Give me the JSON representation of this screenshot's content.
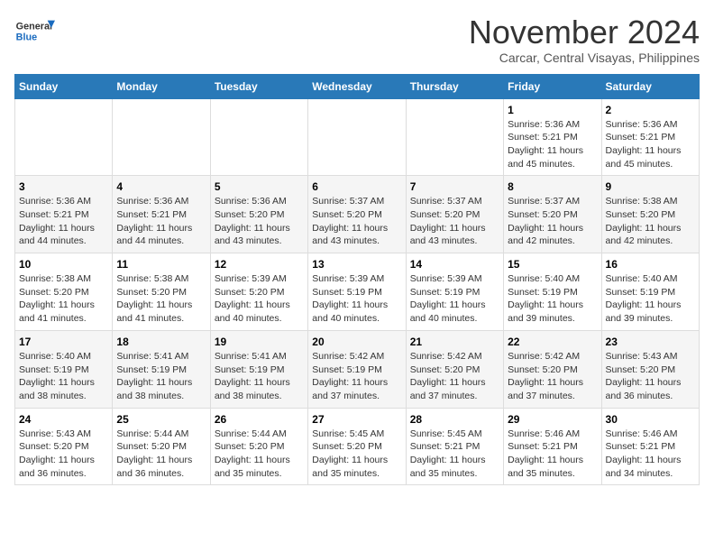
{
  "header": {
    "logo_line1": "General",
    "logo_line2": "Blue",
    "month_title": "November 2024",
    "subtitle": "Carcar, Central Visayas, Philippines"
  },
  "days_of_week": [
    "Sunday",
    "Monday",
    "Tuesday",
    "Wednesday",
    "Thursday",
    "Friday",
    "Saturday"
  ],
  "weeks": [
    [
      {
        "day": "",
        "info": ""
      },
      {
        "day": "",
        "info": ""
      },
      {
        "day": "",
        "info": ""
      },
      {
        "day": "",
        "info": ""
      },
      {
        "day": "",
        "info": ""
      },
      {
        "day": "1",
        "info": "Sunrise: 5:36 AM\nSunset: 5:21 PM\nDaylight: 11 hours and 45 minutes."
      },
      {
        "day": "2",
        "info": "Sunrise: 5:36 AM\nSunset: 5:21 PM\nDaylight: 11 hours and 45 minutes."
      }
    ],
    [
      {
        "day": "3",
        "info": "Sunrise: 5:36 AM\nSunset: 5:21 PM\nDaylight: 11 hours and 44 minutes."
      },
      {
        "day": "4",
        "info": "Sunrise: 5:36 AM\nSunset: 5:21 PM\nDaylight: 11 hours and 44 minutes."
      },
      {
        "day": "5",
        "info": "Sunrise: 5:36 AM\nSunset: 5:20 PM\nDaylight: 11 hours and 43 minutes."
      },
      {
        "day": "6",
        "info": "Sunrise: 5:37 AM\nSunset: 5:20 PM\nDaylight: 11 hours and 43 minutes."
      },
      {
        "day": "7",
        "info": "Sunrise: 5:37 AM\nSunset: 5:20 PM\nDaylight: 11 hours and 43 minutes."
      },
      {
        "day": "8",
        "info": "Sunrise: 5:37 AM\nSunset: 5:20 PM\nDaylight: 11 hours and 42 minutes."
      },
      {
        "day": "9",
        "info": "Sunrise: 5:38 AM\nSunset: 5:20 PM\nDaylight: 11 hours and 42 minutes."
      }
    ],
    [
      {
        "day": "10",
        "info": "Sunrise: 5:38 AM\nSunset: 5:20 PM\nDaylight: 11 hours and 41 minutes."
      },
      {
        "day": "11",
        "info": "Sunrise: 5:38 AM\nSunset: 5:20 PM\nDaylight: 11 hours and 41 minutes."
      },
      {
        "day": "12",
        "info": "Sunrise: 5:39 AM\nSunset: 5:20 PM\nDaylight: 11 hours and 40 minutes."
      },
      {
        "day": "13",
        "info": "Sunrise: 5:39 AM\nSunset: 5:19 PM\nDaylight: 11 hours and 40 minutes."
      },
      {
        "day": "14",
        "info": "Sunrise: 5:39 AM\nSunset: 5:19 PM\nDaylight: 11 hours and 40 minutes."
      },
      {
        "day": "15",
        "info": "Sunrise: 5:40 AM\nSunset: 5:19 PM\nDaylight: 11 hours and 39 minutes."
      },
      {
        "day": "16",
        "info": "Sunrise: 5:40 AM\nSunset: 5:19 PM\nDaylight: 11 hours and 39 minutes."
      }
    ],
    [
      {
        "day": "17",
        "info": "Sunrise: 5:40 AM\nSunset: 5:19 PM\nDaylight: 11 hours and 38 minutes."
      },
      {
        "day": "18",
        "info": "Sunrise: 5:41 AM\nSunset: 5:19 PM\nDaylight: 11 hours and 38 minutes."
      },
      {
        "day": "19",
        "info": "Sunrise: 5:41 AM\nSunset: 5:19 PM\nDaylight: 11 hours and 38 minutes."
      },
      {
        "day": "20",
        "info": "Sunrise: 5:42 AM\nSunset: 5:19 PM\nDaylight: 11 hours and 37 minutes."
      },
      {
        "day": "21",
        "info": "Sunrise: 5:42 AM\nSunset: 5:20 PM\nDaylight: 11 hours and 37 minutes."
      },
      {
        "day": "22",
        "info": "Sunrise: 5:42 AM\nSunset: 5:20 PM\nDaylight: 11 hours and 37 minutes."
      },
      {
        "day": "23",
        "info": "Sunrise: 5:43 AM\nSunset: 5:20 PM\nDaylight: 11 hours and 36 minutes."
      }
    ],
    [
      {
        "day": "24",
        "info": "Sunrise: 5:43 AM\nSunset: 5:20 PM\nDaylight: 11 hours and 36 minutes."
      },
      {
        "day": "25",
        "info": "Sunrise: 5:44 AM\nSunset: 5:20 PM\nDaylight: 11 hours and 36 minutes."
      },
      {
        "day": "26",
        "info": "Sunrise: 5:44 AM\nSunset: 5:20 PM\nDaylight: 11 hours and 35 minutes."
      },
      {
        "day": "27",
        "info": "Sunrise: 5:45 AM\nSunset: 5:20 PM\nDaylight: 11 hours and 35 minutes."
      },
      {
        "day": "28",
        "info": "Sunrise: 5:45 AM\nSunset: 5:21 PM\nDaylight: 11 hours and 35 minutes."
      },
      {
        "day": "29",
        "info": "Sunrise: 5:46 AM\nSunset: 5:21 PM\nDaylight: 11 hours and 35 minutes."
      },
      {
        "day": "30",
        "info": "Sunrise: 5:46 AM\nSunset: 5:21 PM\nDaylight: 11 hours and 34 minutes."
      }
    ]
  ]
}
